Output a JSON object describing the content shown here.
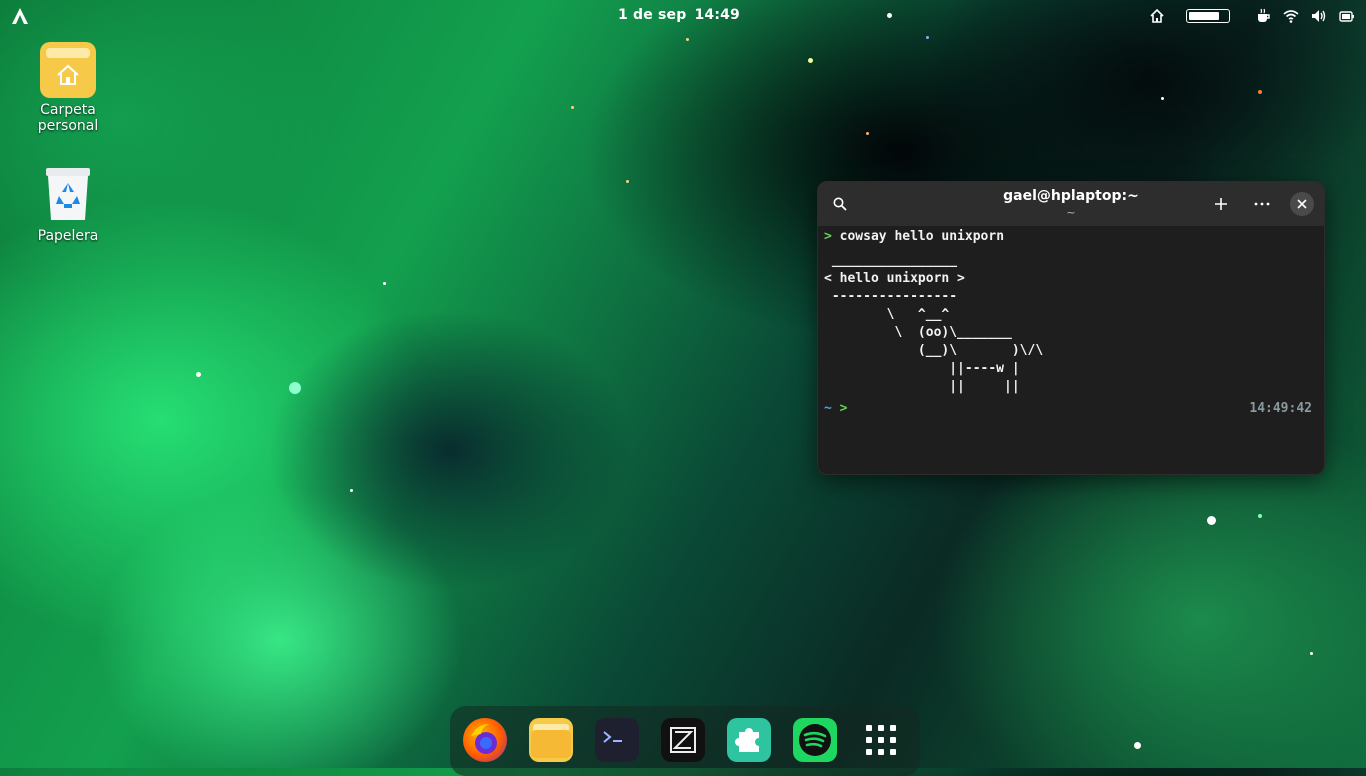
{
  "topbar": {
    "date": "1 de sep",
    "time": "14:49",
    "battery_level": 0.82,
    "icons": [
      "activities-icon",
      "home-icon",
      "battery-icon",
      "coffee-icon",
      "wifi-icon",
      "volume-icon",
      "battery-status-icon"
    ]
  },
  "desktop": {
    "icons": [
      {
        "label": "Carpeta personal",
        "icon": "home-folder-icon"
      },
      {
        "label": "Papelera",
        "icon": "trash-icon"
      }
    ]
  },
  "terminal": {
    "title": "gael@hplaptop:~",
    "subtitle": "~",
    "command_prompt": ">",
    "command": "cowsay hello unixporn",
    "output": [
      " ________________",
      "< hello unixporn >",
      " ----------------",
      "        \\   ^__^",
      "         \\  (oo)\\_______",
      "            (__)\\       )\\/\\",
      "                ||----w |",
      "                ||     ||"
    ],
    "cwd_prompt": "~",
    "prompt2": ">",
    "right_time": "14:49:42"
  },
  "dock": {
    "apps": [
      "firefox-icon",
      "files-icon",
      "terminal-icon",
      "zed-editor-icon",
      "extensions-icon",
      "spotify-icon",
      "app-grid-icon"
    ]
  },
  "colors": {
    "prompt_green": "#6ad05a",
    "prompt_blue": "#4aa3df",
    "folder_yellow": "#f7c948",
    "spotify_green": "#1ed760",
    "extensions_teal": "#2ec4a0"
  }
}
